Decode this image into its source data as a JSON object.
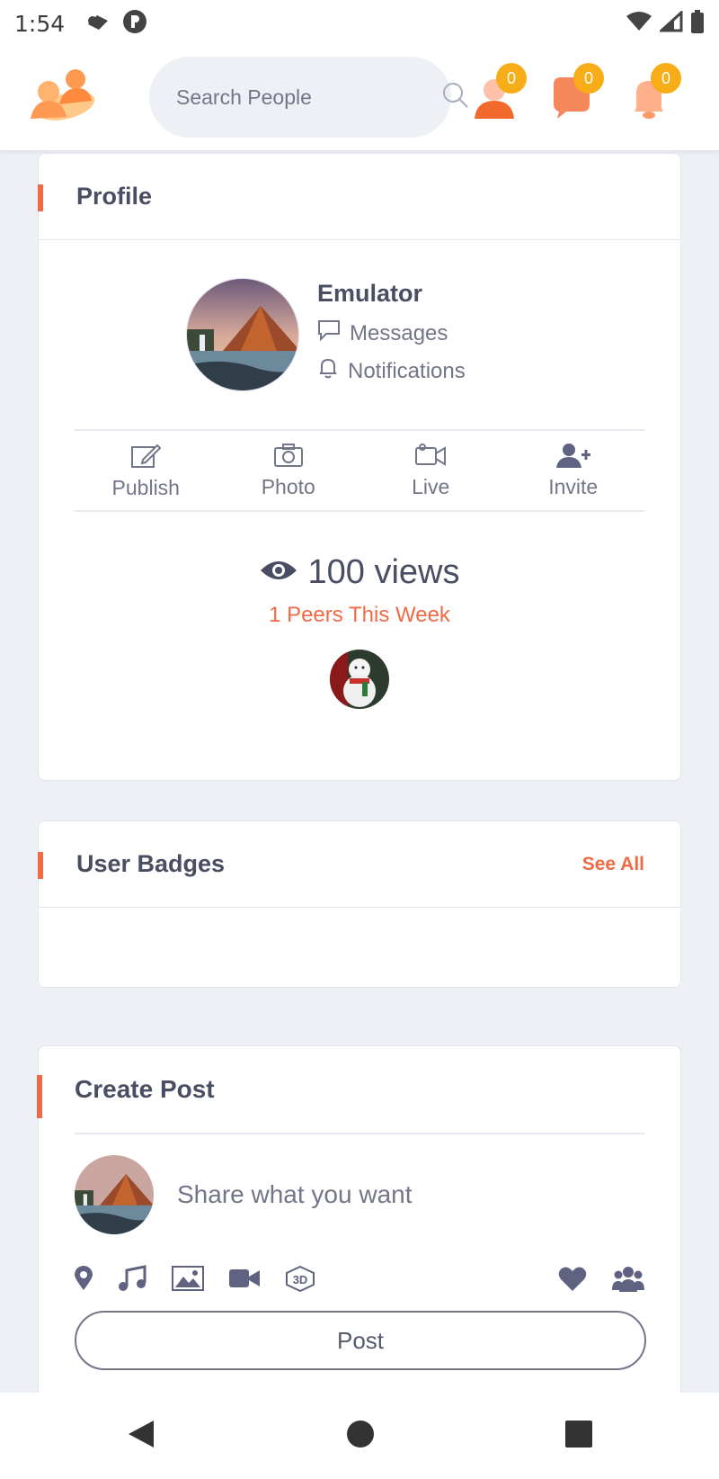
{
  "status_bar": {
    "time": "1:54",
    "icons": [
      "cloud-icon",
      "app-p-icon",
      "wifi-icon",
      "signal-icon",
      "battery-icon"
    ]
  },
  "header": {
    "logo": "users-logo-icon",
    "search": {
      "placeholder": "Search People",
      "icon": "search-icon"
    },
    "nav": [
      {
        "icon": "friend-requests-icon",
        "count": "0"
      },
      {
        "icon": "messages-icon",
        "count": "0"
      },
      {
        "icon": "notifications-bell-icon",
        "count": "0"
      }
    ],
    "accent_color": "#ef6a45",
    "badge_color": "#f7ad17"
  },
  "profile_card": {
    "title": "Profile",
    "name": "Emulator",
    "links": {
      "messages": "Messages",
      "notifications": "Notifications"
    },
    "actions": [
      {
        "label": "Publish",
        "icon": "edit-icon"
      },
      {
        "label": "Photo",
        "icon": "camera-icon"
      },
      {
        "label": "Live",
        "icon": "video-camera-icon"
      },
      {
        "label": "Invite",
        "icon": "user-plus-icon"
      }
    ],
    "views": "100 views",
    "peers": "1 Peers This Week"
  },
  "badges_card": {
    "title": "User Badges",
    "see_all": "See All"
  },
  "create_post": {
    "title": "Create Post",
    "placeholder": "Share what you want",
    "tools": [
      "location-icon",
      "music-icon",
      "image-icon",
      "video-icon",
      "3d-icon"
    ],
    "tools_right": [
      "heart-icon",
      "group-icon"
    ],
    "post_label": "Post"
  },
  "android_nav": [
    "back-icon",
    "home-icon",
    "recents-icon"
  ]
}
